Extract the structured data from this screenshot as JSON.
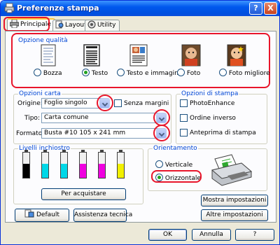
{
  "window": {
    "title": "Preferenze stampa",
    "help_label": "?",
    "close_label": "X"
  },
  "tabs": [
    {
      "label": "Principale",
      "icon": "printer-icon"
    },
    {
      "label": "Layout",
      "icon": "layout-icon"
    },
    {
      "label": "Utility",
      "icon": "utility-icon"
    }
  ],
  "quality": {
    "group_label": "Opzione qualità",
    "options": [
      {
        "label": "Bozza",
        "selected": false,
        "icon": "draft-page-icon"
      },
      {
        "label": "Testo",
        "selected": true,
        "icon": "text-page-icon"
      },
      {
        "label": "Testo e immagine",
        "selected": false,
        "icon": "text-image-page-icon"
      },
      {
        "label": "Foto",
        "selected": false,
        "icon": "photo-icon"
      },
      {
        "label": "Foto migliore",
        "selected": false,
        "icon": "best-photo-icon"
      }
    ]
  },
  "paper": {
    "group_label": "Opzioni carta",
    "origin_label": "Origine:",
    "origin_value": "Foglio singolo",
    "borderless_label": "Senza margini",
    "type_label": "Tipo:",
    "type_value": "Carta comune",
    "format_label": "Formato:",
    "format_value": "Busta #10 105 x 241 mm"
  },
  "print_options": {
    "group_label": "Opzioni di stampa",
    "items": [
      {
        "label": "PhotoEnhance",
        "checked": false
      },
      {
        "label": "Ordine inverso",
        "checked": false
      },
      {
        "label": "Anteprima di stampa",
        "checked": false
      }
    ]
  },
  "ink": {
    "group_label": "Livelli inchiostro",
    "levels": [
      {
        "color": "#000000",
        "level": 0.55
      },
      {
        "color": "#00D8E8",
        "level": 0.55
      },
      {
        "color": "#00D8E8",
        "level": 0.55
      },
      {
        "color": "#F000E0",
        "level": 0.55
      },
      {
        "color": "#F000E0",
        "level": 0.55
      },
      {
        "color": "#F2F000",
        "level": 0.55
      }
    ],
    "buy_label": "Per acquistare"
  },
  "orientation": {
    "group_label": "Orientamento",
    "options": [
      {
        "label": "Verticale",
        "selected": false
      },
      {
        "label": "Orizzontale",
        "selected": true
      }
    ]
  },
  "buttons": {
    "default_label": "Default",
    "support_label": "Assistenza tecnica",
    "show_settings_label": "Mostra impostazioni",
    "other_settings_label": "Altre impostazioni",
    "ok_label": "OK",
    "cancel_label": "Annulla",
    "help_label": "?"
  },
  "colors": {
    "highlight": "#E8152B",
    "group_label": "#0046D5",
    "title_bar": "#0058EE"
  }
}
